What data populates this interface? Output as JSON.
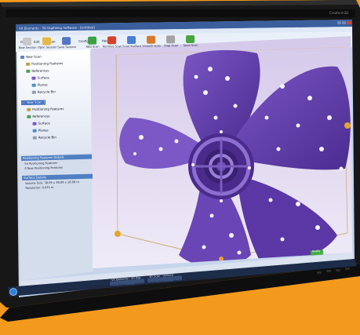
{
  "window": {
    "title": "VX Elements - 3D Digitizing Software - [Untitled]",
    "top_bar_right": "Creaform3D",
    "controls": [
      "minimize",
      "maximize",
      "close"
    ]
  },
  "menu": [
    "File",
    "Edit",
    "Scan",
    "View",
    "Configure",
    "Help"
  ],
  "toolbar": [
    {
      "label": "New Session",
      "icon": "new-session-icon",
      "color": "#c9c9c9"
    },
    {
      "label": "Open Session",
      "icon": "open-session-icon",
      "color": "#e6b845"
    },
    {
      "label": "Save Session",
      "icon": "save-session-icon",
      "color": "#5177c4"
    },
    {
      "label": "Add Scan",
      "icon": "add-scan-icon",
      "color": "#3aa243"
    },
    {
      "label": "Remove Scan",
      "icon": "remove-scan-icon",
      "color": "#d8402c"
    },
    {
      "label": "Scan Surface",
      "icon": "scan-surface-icon",
      "color": "#4a7ed6"
    },
    {
      "label": "Smooth Scan",
      "icon": "smooth-scan-icon",
      "color": "#d97a2a"
    },
    {
      "label": "Stop Scan",
      "icon": "stop-scan-icon",
      "color": "#a3a3a3"
    },
    {
      "label": "Save Scan",
      "icon": "save-scan-icon",
      "color": "#48a63c"
    }
  ],
  "tree": [
    {
      "label": "New Scan",
      "level": 0,
      "icon": "scan-root-icon"
    },
    {
      "label": "Positioning Features",
      "level": 1,
      "icon": "positioning-icon"
    },
    {
      "label": "References",
      "level": 1,
      "icon": "references-icon"
    },
    {
      "label": "Surface",
      "level": 2,
      "icon": "surface-icon"
    },
    {
      "label": "Planes",
      "level": 2,
      "icon": "planes-icon"
    },
    {
      "label": "Recycle Bin",
      "level": 2,
      "icon": "recycle-bin-icon"
    },
    {
      "label": "New Scan 1",
      "level": 0,
      "icon": "scan-root-icon",
      "selected": true
    },
    {
      "label": "Positioning Features",
      "level": 1,
      "icon": "positioning-icon"
    },
    {
      "label": "References",
      "level": 1,
      "icon": "references-icon"
    },
    {
      "label": "Surface",
      "level": 2,
      "icon": "surface-icon"
    },
    {
      "label": "Planes",
      "level": 2,
      "icon": "planes-icon"
    },
    {
      "label": "Recycle Bin",
      "level": 2,
      "icon": "recycle-bin-icon"
    }
  ],
  "positioning_panel": {
    "title": "Positioning Features Details",
    "lines": [
      "54 Positioning Features",
      "0 New Positioning Features"
    ]
  },
  "surface_panel": {
    "title": "Surface Details",
    "lines": [
      "Volume Size: 38.09 x 38.09 x 18.08 m",
      "Resolution: 0.635 m"
    ]
  },
  "statusbar": {
    "items": [
      "Left Button: Rotate",
      "Left + Right Button: Span",
      "Middle Button: Pan",
      "Mouse wheel: Zoom"
    ],
    "badge": "Ready"
  },
  "taskbar": {
    "items": [
      "VX Elements - 3D Digi",
      "3D Scan - Untitled"
    ]
  },
  "colors": {
    "background": "#f39a1c",
    "bezel": "#161616",
    "viewport_top": "#d7ccec",
    "viewport_bottom": "#ece8f5",
    "model": "#6a44b0",
    "model_dark": "#3b2270",
    "panel_head": "#4f7fc2"
  }
}
